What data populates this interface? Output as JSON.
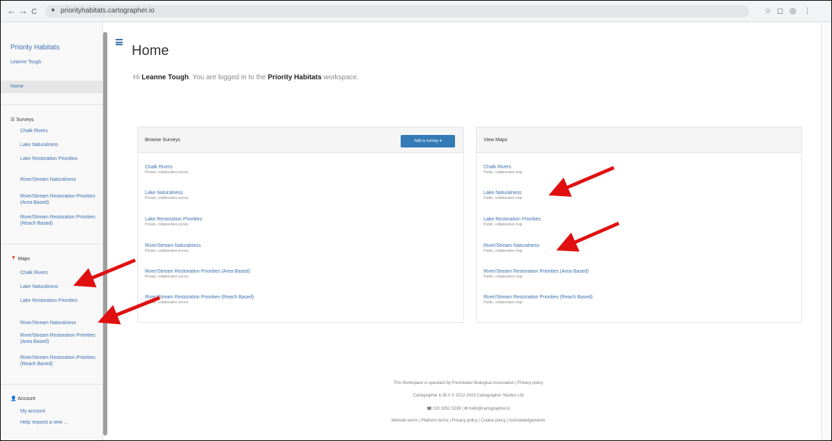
{
  "browser": {
    "url": "priorityhabitats.cartographer.io",
    "nav_back": "←",
    "nav_forward": "→",
    "nav_reload": "C",
    "toolbar_icons": [
      "☆",
      "◻",
      "◎",
      "⋮"
    ]
  },
  "sidebar": {
    "brand": "Priority Habitats",
    "user": "Leanne Tough",
    "home": "Home",
    "surveys_heading": "Surveys",
    "surveys": [
      "Chalk Rivers",
      "Lake Naturalness",
      "Lake Restoration Priorities",
      "River/Stream Naturalness",
      "River/Stream Restoration Priorities (Area Based)",
      "River/Stream Restoration Priorities (Reach Based)"
    ],
    "maps_heading": "Maps",
    "maps": [
      "Chalk Rivers",
      "Lake Naturalness",
      "Lake Restoration Priorities",
      "River/Stream Naturalness",
      "River/Stream Restoration Priorities (Area Based)",
      "River/Stream Restoration Priorities (Reach Based)"
    ],
    "account_heading": "Account",
    "account_links": [
      "My account",
      "Help request a new ..."
    ]
  },
  "main": {
    "title": "Home",
    "greeting_prefix": "Hi",
    "user_name": "Leanne Tough",
    "greeting_middle": ". You are logged in to the",
    "workspace_name": "Priority Habitats",
    "greeting_suffix": "workspace."
  },
  "surveys_panel": {
    "title": "Browse Surveys",
    "add_button": "Add a survey ▾",
    "items": [
      {
        "title": "Chalk Rivers",
        "subtitle": "Private, collaborative survey"
      },
      {
        "title": "Lake Naturalness",
        "subtitle": "Private, collaborative survey"
      },
      {
        "title": "Lake Restoration Priorities",
        "subtitle": "Private, collaborative survey"
      },
      {
        "title": "River/Stream Naturalness",
        "subtitle": "Private, collaborative survey"
      },
      {
        "title": "River/Stream Restoration Priorities (Area Based)",
        "subtitle": "Private, collaborative survey"
      },
      {
        "title": "River/Stream Restoration Priorities (Reach Based)",
        "subtitle": "Private, collaborative survey"
      }
    ]
  },
  "maps_panel": {
    "title": "View Maps",
    "items": [
      {
        "title": "Chalk Rivers",
        "subtitle": "Public, collaborative map"
      },
      {
        "title": "Lake Naturalness",
        "subtitle": "Public, collaborative map"
      },
      {
        "title": "Lake Restoration Priorities",
        "subtitle": "Public, collaborative map"
      },
      {
        "title": "River/Stream Naturalness",
        "subtitle": "Public, collaborative map"
      },
      {
        "title": "River/Stream Restoration Priorities (Area Based)",
        "subtitle": "Public, collaborative map"
      },
      {
        "title": "River/Stream Restoration Priorities (Reach Based)",
        "subtitle": "Public, collaborative map"
      }
    ]
  },
  "footer": {
    "operated_by": "This Workspace is operated by Freshwater Biological Association",
    "privacy_policy": "Privacy policy",
    "copyright": "Cartographer 6.38.0 © 2012-2019 Cartographer Studios Ltd",
    "phone": "020 3051 5339",
    "email": "hello@cartographer.io",
    "links": "Website terms | Platform terms | Privacy policy | Cookie policy | Acknowledgements"
  },
  "annotation_color": "#e01010"
}
